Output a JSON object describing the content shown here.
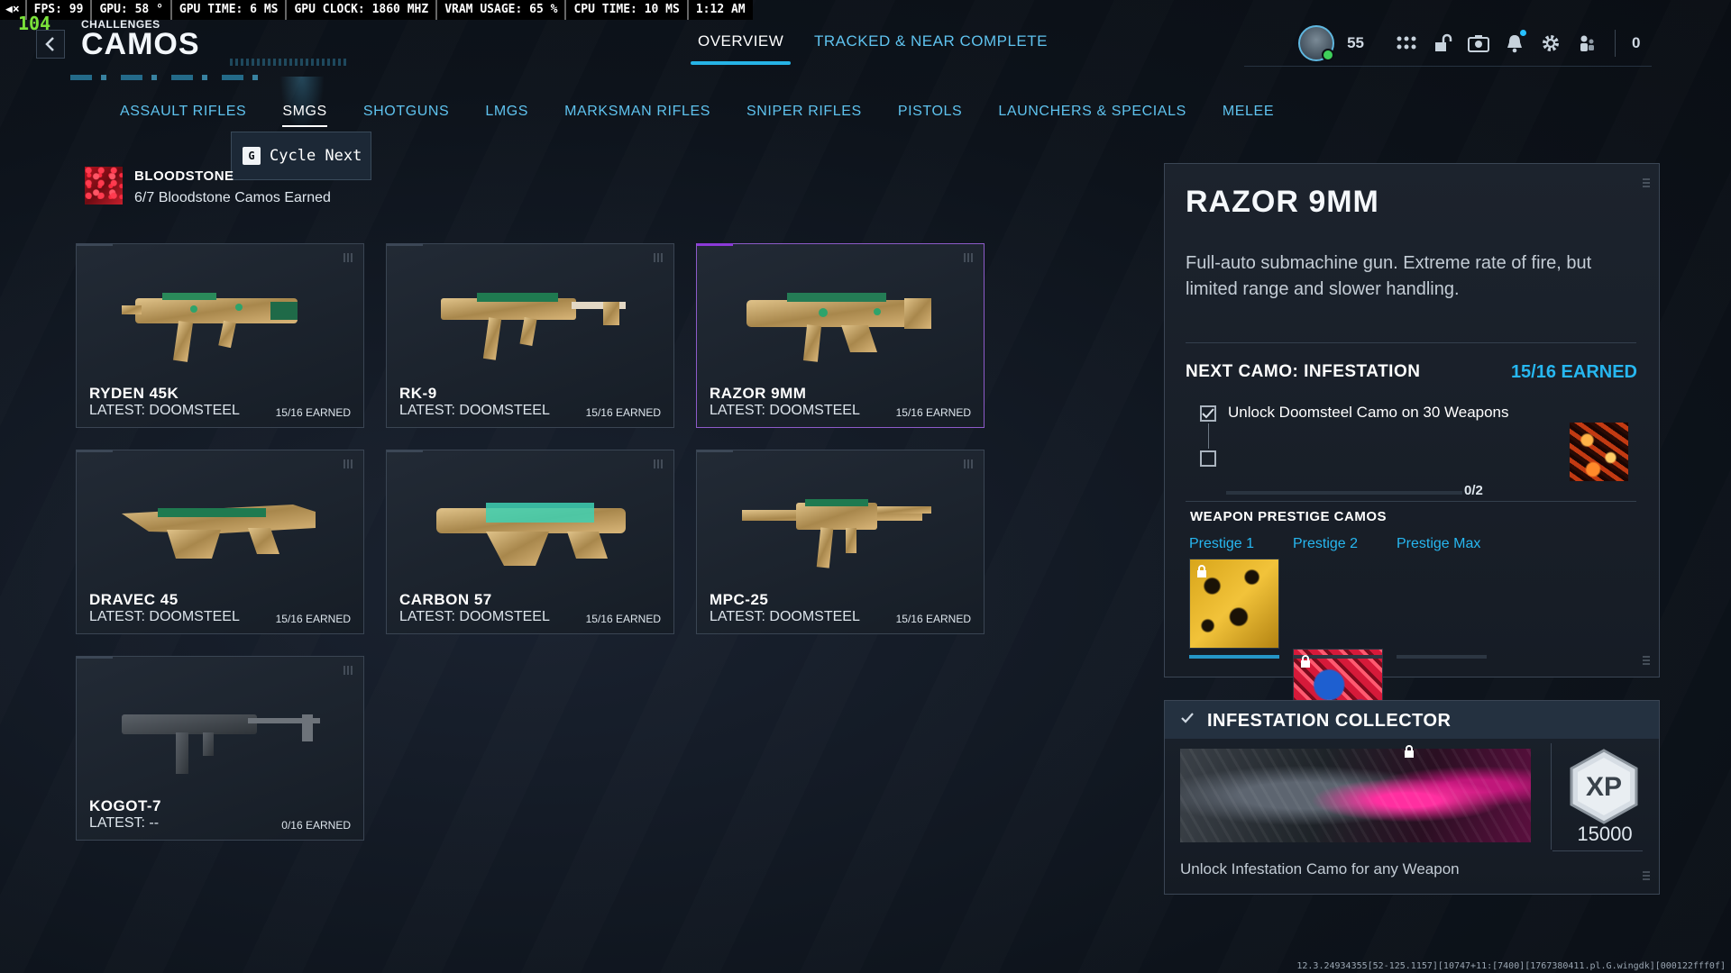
{
  "perf": {
    "mute": "◀×",
    "fps": "FPS:  99",
    "gpu": "GPU: 58 °",
    "gpu_time": "GPU TIME:  6 MS",
    "gpu_clock": "GPU CLOCK: 1860 MHZ",
    "vram": "VRAM USAGE: 65 %",
    "cpu_time": "CPU TIME: 10 MS",
    "clock": "1:12 AM",
    "fps_overlay": "104"
  },
  "header": {
    "breadcrumb": "CHALLENGES",
    "title": "CAMOS",
    "back_icon": "chevron-left-icon",
    "tabs": [
      {
        "label": "OVERVIEW",
        "active": true
      },
      {
        "label": "TRACKED & NEAR COMPLETE",
        "active": false
      }
    ],
    "player_level": "55",
    "notification_count": "0",
    "icons": [
      "grid-icon",
      "unlock-icon",
      "camera-icon",
      "bell-icon",
      "gear-icon",
      "party-icon"
    ]
  },
  "categories": [
    {
      "label": "ASSAULT RIFLES",
      "active": false
    },
    {
      "label": "SMGS",
      "active": true
    },
    {
      "label": "SHOTGUNS",
      "active": false
    },
    {
      "label": "LMGS",
      "active": false
    },
    {
      "label": "MARKSMAN RIFLES",
      "active": false
    },
    {
      "label": "SNIPER RIFLES",
      "active": false
    },
    {
      "label": "PISTOLS",
      "active": false
    },
    {
      "label": "LAUNCHERS & SPECIALS",
      "active": false
    },
    {
      "label": "MELEE",
      "active": false
    }
  ],
  "tooltip": {
    "key": "G",
    "label": "Cycle Next"
  },
  "bloodstone": {
    "name": "BLOODSTONE",
    "progress": "6/7 Bloodstone Camos Earned"
  },
  "weapons": [
    {
      "name": "RYDEN 45K",
      "latest": "LATEST: DOOMSTEEL",
      "earned": "15/16 EARNED"
    },
    {
      "name": "RK-9",
      "latest": "LATEST: DOOMSTEEL",
      "earned": "15/16 EARNED"
    },
    {
      "name": "RAZOR 9MM",
      "latest": "LATEST: DOOMSTEEL",
      "earned": "15/16 EARNED"
    },
    {
      "name": "DRAVEC 45",
      "latest": "LATEST: DOOMSTEEL",
      "earned": "15/16 EARNED"
    },
    {
      "name": "CARBON 57",
      "latest": "LATEST: DOOMSTEEL",
      "earned": "15/16 EARNED"
    },
    {
      "name": "MPC-25",
      "latest": "LATEST: DOOMSTEEL",
      "earned": "15/16 EARNED"
    },
    {
      "name": "KOGOT-7",
      "latest": "LATEST: --",
      "earned": "0/16 EARNED"
    }
  ],
  "detail": {
    "name": "RAZOR 9MM",
    "description": "Full-auto submachine gun. Extreme rate of fire, but limited range and slower handling.",
    "next_camo": "NEXT CAMO: INFESTATION",
    "earned": "15/16 EARNED",
    "challenge": "Unlock Doomsteel Camo on 30 Weapons",
    "progress": "0/2",
    "progress_fraction": 0,
    "prestige_header": "WEAPON PRESTIGE CAMOS",
    "prestige": [
      {
        "label": "Prestige 1",
        "locked": true
      },
      {
        "label": "Prestige 2",
        "locked": true
      },
      {
        "label": "Prestige Max",
        "locked": true
      }
    ]
  },
  "collector": {
    "title": "INFESTATION COLLECTOR",
    "xp_badge": "XP",
    "xp": "15000",
    "description": "Unlock Infestation Camo for any Weapon"
  },
  "build": "12.3.24934355[52-125.1157][10747+11:[7400][1767380411.pl.G.wingdk][000122fff0f]"
}
